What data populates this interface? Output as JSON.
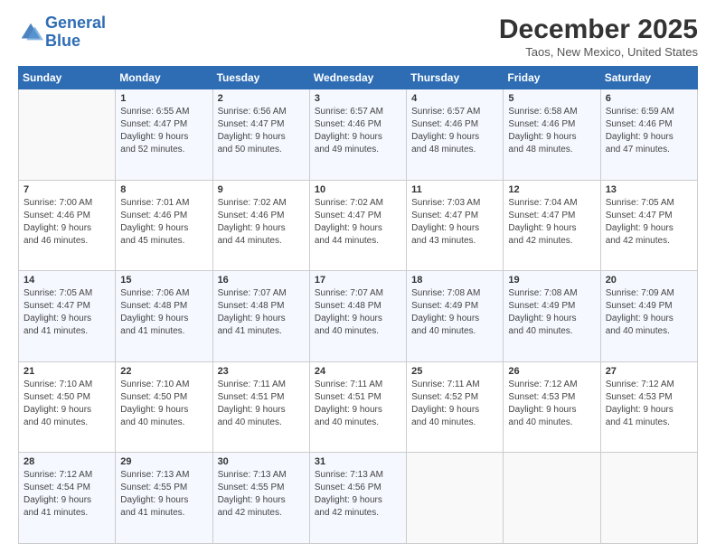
{
  "header": {
    "logo_line1": "General",
    "logo_line2": "Blue",
    "title": "December 2025",
    "subtitle": "Taos, New Mexico, United States"
  },
  "weekdays": [
    "Sunday",
    "Monday",
    "Tuesday",
    "Wednesday",
    "Thursday",
    "Friday",
    "Saturday"
  ],
  "weeks": [
    [
      {
        "day": "",
        "info": ""
      },
      {
        "day": "1",
        "info": "Sunrise: 6:55 AM\nSunset: 4:47 PM\nDaylight: 9 hours\nand 52 minutes."
      },
      {
        "day": "2",
        "info": "Sunrise: 6:56 AM\nSunset: 4:47 PM\nDaylight: 9 hours\nand 50 minutes."
      },
      {
        "day": "3",
        "info": "Sunrise: 6:57 AM\nSunset: 4:46 PM\nDaylight: 9 hours\nand 49 minutes."
      },
      {
        "day": "4",
        "info": "Sunrise: 6:57 AM\nSunset: 4:46 PM\nDaylight: 9 hours\nand 48 minutes."
      },
      {
        "day": "5",
        "info": "Sunrise: 6:58 AM\nSunset: 4:46 PM\nDaylight: 9 hours\nand 48 minutes."
      },
      {
        "day": "6",
        "info": "Sunrise: 6:59 AM\nSunset: 4:46 PM\nDaylight: 9 hours\nand 47 minutes."
      }
    ],
    [
      {
        "day": "7",
        "info": "Sunrise: 7:00 AM\nSunset: 4:46 PM\nDaylight: 9 hours\nand 46 minutes."
      },
      {
        "day": "8",
        "info": "Sunrise: 7:01 AM\nSunset: 4:46 PM\nDaylight: 9 hours\nand 45 minutes."
      },
      {
        "day": "9",
        "info": "Sunrise: 7:02 AM\nSunset: 4:46 PM\nDaylight: 9 hours\nand 44 minutes."
      },
      {
        "day": "10",
        "info": "Sunrise: 7:02 AM\nSunset: 4:47 PM\nDaylight: 9 hours\nand 44 minutes."
      },
      {
        "day": "11",
        "info": "Sunrise: 7:03 AM\nSunset: 4:47 PM\nDaylight: 9 hours\nand 43 minutes."
      },
      {
        "day": "12",
        "info": "Sunrise: 7:04 AM\nSunset: 4:47 PM\nDaylight: 9 hours\nand 42 minutes."
      },
      {
        "day": "13",
        "info": "Sunrise: 7:05 AM\nSunset: 4:47 PM\nDaylight: 9 hours\nand 42 minutes."
      }
    ],
    [
      {
        "day": "14",
        "info": "Sunrise: 7:05 AM\nSunset: 4:47 PM\nDaylight: 9 hours\nand 41 minutes."
      },
      {
        "day": "15",
        "info": "Sunrise: 7:06 AM\nSunset: 4:48 PM\nDaylight: 9 hours\nand 41 minutes."
      },
      {
        "day": "16",
        "info": "Sunrise: 7:07 AM\nSunset: 4:48 PM\nDaylight: 9 hours\nand 41 minutes."
      },
      {
        "day": "17",
        "info": "Sunrise: 7:07 AM\nSunset: 4:48 PM\nDaylight: 9 hours\nand 40 minutes."
      },
      {
        "day": "18",
        "info": "Sunrise: 7:08 AM\nSunset: 4:49 PM\nDaylight: 9 hours\nand 40 minutes."
      },
      {
        "day": "19",
        "info": "Sunrise: 7:08 AM\nSunset: 4:49 PM\nDaylight: 9 hours\nand 40 minutes."
      },
      {
        "day": "20",
        "info": "Sunrise: 7:09 AM\nSunset: 4:49 PM\nDaylight: 9 hours\nand 40 minutes."
      }
    ],
    [
      {
        "day": "21",
        "info": "Sunrise: 7:10 AM\nSunset: 4:50 PM\nDaylight: 9 hours\nand 40 minutes."
      },
      {
        "day": "22",
        "info": "Sunrise: 7:10 AM\nSunset: 4:50 PM\nDaylight: 9 hours\nand 40 minutes."
      },
      {
        "day": "23",
        "info": "Sunrise: 7:11 AM\nSunset: 4:51 PM\nDaylight: 9 hours\nand 40 minutes."
      },
      {
        "day": "24",
        "info": "Sunrise: 7:11 AM\nSunset: 4:51 PM\nDaylight: 9 hours\nand 40 minutes."
      },
      {
        "day": "25",
        "info": "Sunrise: 7:11 AM\nSunset: 4:52 PM\nDaylight: 9 hours\nand 40 minutes."
      },
      {
        "day": "26",
        "info": "Sunrise: 7:12 AM\nSunset: 4:53 PM\nDaylight: 9 hours\nand 40 minutes."
      },
      {
        "day": "27",
        "info": "Sunrise: 7:12 AM\nSunset: 4:53 PM\nDaylight: 9 hours\nand 41 minutes."
      }
    ],
    [
      {
        "day": "28",
        "info": "Sunrise: 7:12 AM\nSunset: 4:54 PM\nDaylight: 9 hours\nand 41 minutes."
      },
      {
        "day": "29",
        "info": "Sunrise: 7:13 AM\nSunset: 4:55 PM\nDaylight: 9 hours\nand 41 minutes."
      },
      {
        "day": "30",
        "info": "Sunrise: 7:13 AM\nSunset: 4:55 PM\nDaylight: 9 hours\nand 42 minutes."
      },
      {
        "day": "31",
        "info": "Sunrise: 7:13 AM\nSunset: 4:56 PM\nDaylight: 9 hours\nand 42 minutes."
      },
      {
        "day": "",
        "info": ""
      },
      {
        "day": "",
        "info": ""
      },
      {
        "day": "",
        "info": ""
      }
    ]
  ]
}
